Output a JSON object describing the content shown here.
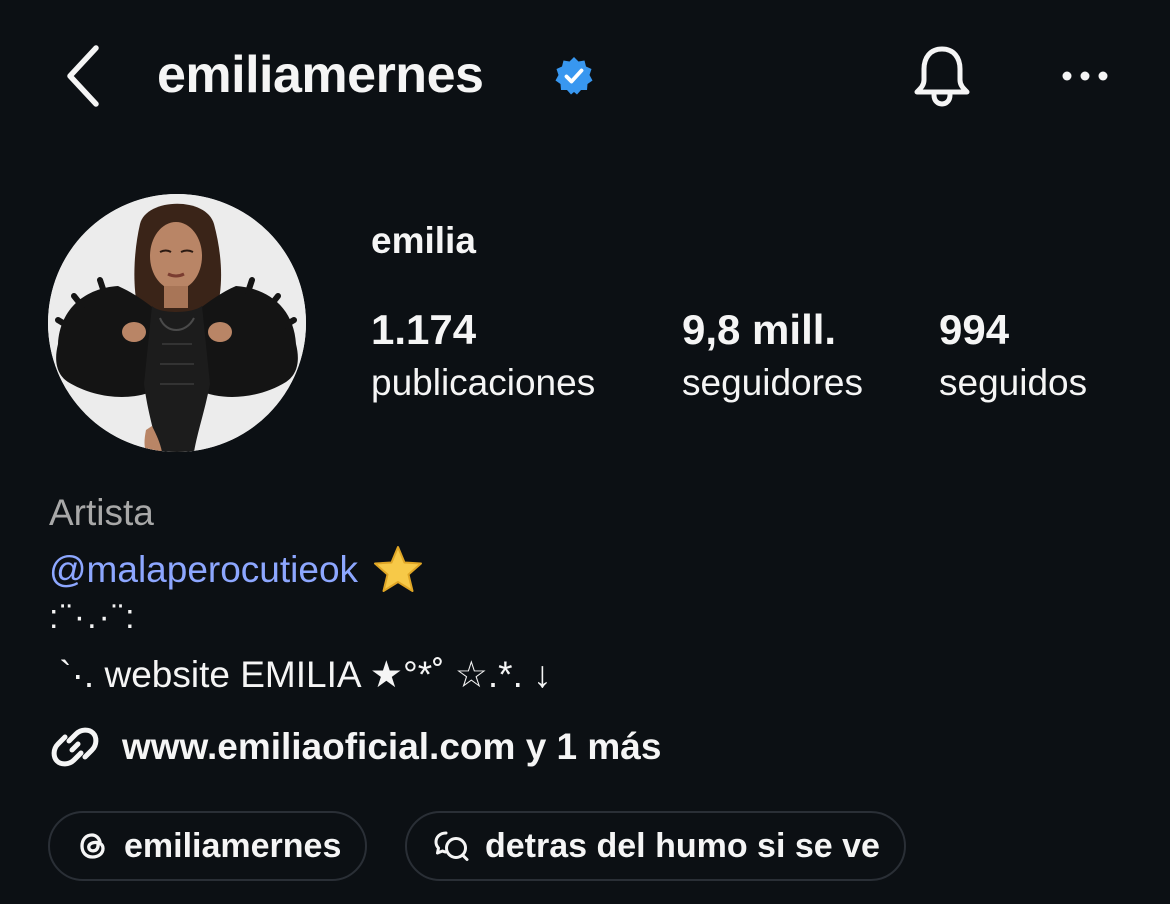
{
  "header": {
    "username": "emiliamernes",
    "back_icon": "chevron-left-icon",
    "verified_icon": "verified-badge-icon",
    "bell_icon": "bell-icon",
    "more_icon": "more-horizontal-icon",
    "verified_color": "#3897f0"
  },
  "profile": {
    "avatar_icon": "profile-photo",
    "full_name": "emilia",
    "stats": [
      {
        "value": "1.174",
        "label": "publicaciones"
      },
      {
        "value": "9,8 mill.",
        "label": "seguidores"
      },
      {
        "value": "994",
        "label": "seguidos"
      }
    ]
  },
  "bio": {
    "category": "Artista",
    "mention": "@malaperocutieok",
    "mention_emoji": "star-emoji",
    "line1": ":¨·.·¨:",
    "line2": " `·. website EMILIA ★°*˚ ☆.*. ↓",
    "link_icon": "link-icon",
    "link_text": "www.emiliaoficial.com y 1 más",
    "mention_color": "#8da7ff",
    "category_color": "#a8a8a8"
  },
  "pills": {
    "threads_label": "emiliamernes",
    "threads_icon": "threads-icon",
    "channel_label": "detras del humo si se ve",
    "channel_icon": "broadcast-chat-icon"
  },
  "theme": {
    "background": "#0c1014",
    "text": "#f5f5f5",
    "border": "#2a2f36"
  }
}
